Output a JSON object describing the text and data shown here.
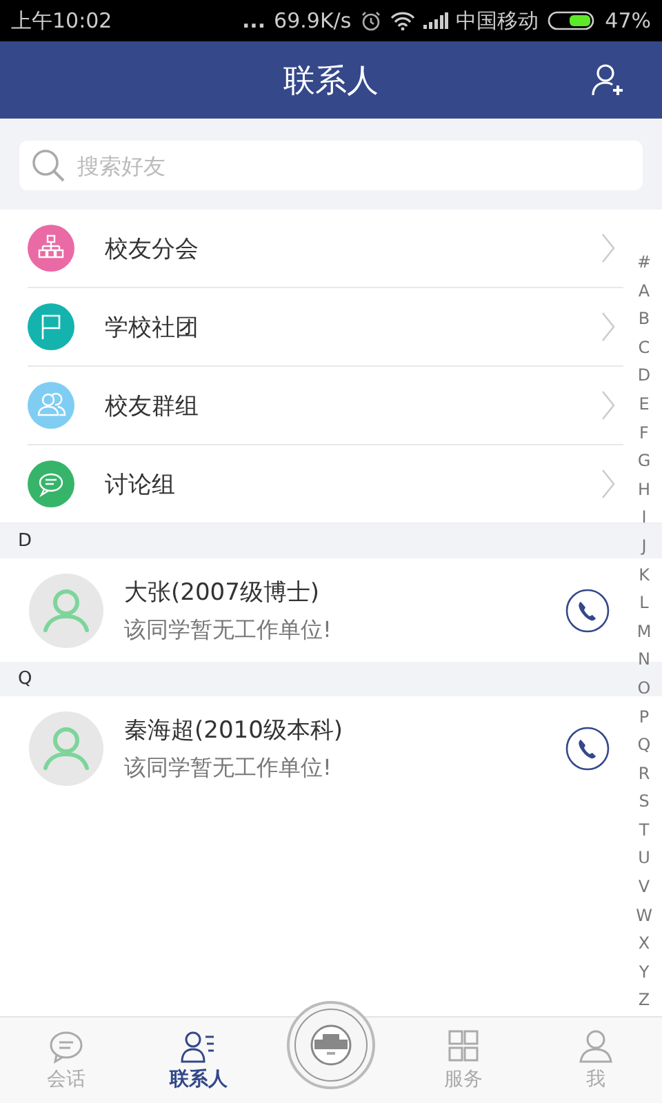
{
  "status_bar": {
    "time": "上午10:02",
    "dots": "...",
    "speed": "69.9K/s",
    "carrier": "中国移动",
    "battery": "47%"
  },
  "header": {
    "title": "联系人"
  },
  "search": {
    "placeholder": "搜索好友"
  },
  "menu": [
    {
      "kind": "branch",
      "label": "校友分会",
      "color": "#ea6aa5"
    },
    {
      "kind": "club",
      "label": "学校社团",
      "color": "#14b3ae"
    },
    {
      "kind": "group",
      "label": "校友群组",
      "color": "#7fcdf3"
    },
    {
      "kind": "discussion",
      "label": "讨论组",
      "color": "#36b56a"
    }
  ],
  "sections": [
    {
      "letter": "D",
      "contacts": [
        {
          "name": "大张(2007级博士)",
          "note": "该同学暂无工作单位!"
        }
      ]
    },
    {
      "letter": "Q",
      "contacts": [
        {
          "name": "秦海超(2010级本科)",
          "note": "该同学暂无工作单位!"
        }
      ]
    }
  ],
  "index": [
    "#",
    "A",
    "B",
    "C",
    "D",
    "E",
    "F",
    "G",
    "H",
    "I",
    "J",
    "K",
    "L",
    "M",
    "N",
    "O",
    "P",
    "Q",
    "R",
    "S",
    "T",
    "U",
    "V",
    "W",
    "X",
    "Y",
    "Z"
  ],
  "tabs": [
    {
      "kind": "chat",
      "label": "会话",
      "selected": false
    },
    {
      "kind": "contacts",
      "label": "联系人",
      "selected": true
    },
    {
      "kind": "logo"
    },
    {
      "kind": "services",
      "label": "服务",
      "selected": false
    },
    {
      "kind": "me",
      "label": "我",
      "selected": false
    }
  ]
}
